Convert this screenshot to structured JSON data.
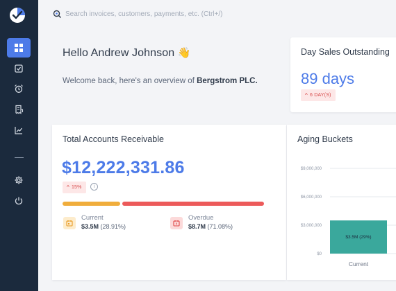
{
  "search": {
    "placeholder": "Search invoices, customers, payments, etc. (Ctrl+/)"
  },
  "sidebar": {
    "items": [
      {
        "name": "dashboard",
        "icon": "dashboard-icon",
        "active": true
      },
      {
        "name": "checklist",
        "icon": "checkbox-icon"
      },
      {
        "name": "reminders",
        "icon": "alarm-clock-icon"
      },
      {
        "name": "invoices",
        "icon": "receipt-icon"
      },
      {
        "name": "reports",
        "icon": "line-chart-icon"
      },
      {
        "name": "settings",
        "icon": "gear-icon"
      },
      {
        "name": "logout",
        "icon": "power-icon"
      }
    ]
  },
  "greeting": {
    "title": "Hello Andrew Johnson",
    "emoji": "👋",
    "subtitle_prefix": "Welcome back, here's an overview of ",
    "company": "Bergstrom PLC."
  },
  "dso": {
    "title": "Day Sales Outstanding",
    "value": "89 days",
    "badge": "6 DAY(S)"
  },
  "receivable": {
    "title": "Total Accounts Receivable",
    "amount": "$12,222,331.86",
    "badge": "15%",
    "info": "i",
    "current": {
      "label": "Current",
      "amount": "$3.5M",
      "percent": "(28.91%)",
      "share": 28.91
    },
    "overdue": {
      "label": "Overdue",
      "amount": "$8.7M",
      "percent": "(71.08%)",
      "share": 71.08
    }
  },
  "colors": {
    "accent": "#4d7be8",
    "sidebar": "#1b2a3d",
    "current": "#f0ad3c",
    "overdue": "#ec5a5a",
    "teal": "#3aa89c",
    "badge_bg": "#fde7e7",
    "badge_text": "#d64848"
  },
  "aging": {
    "title": "Aging Buckets",
    "chart_data": {
      "type": "bar",
      "categories": [
        "Current"
      ],
      "values": [
        3500000
      ],
      "data_labels": [
        "$3.5M (29%)"
      ],
      "yticks": [
        "$9,000,000",
        "$6,000,000",
        "$3,000,000",
        "$0"
      ],
      "ylim": [
        0,
        9000000
      ],
      "grid": true
    }
  }
}
